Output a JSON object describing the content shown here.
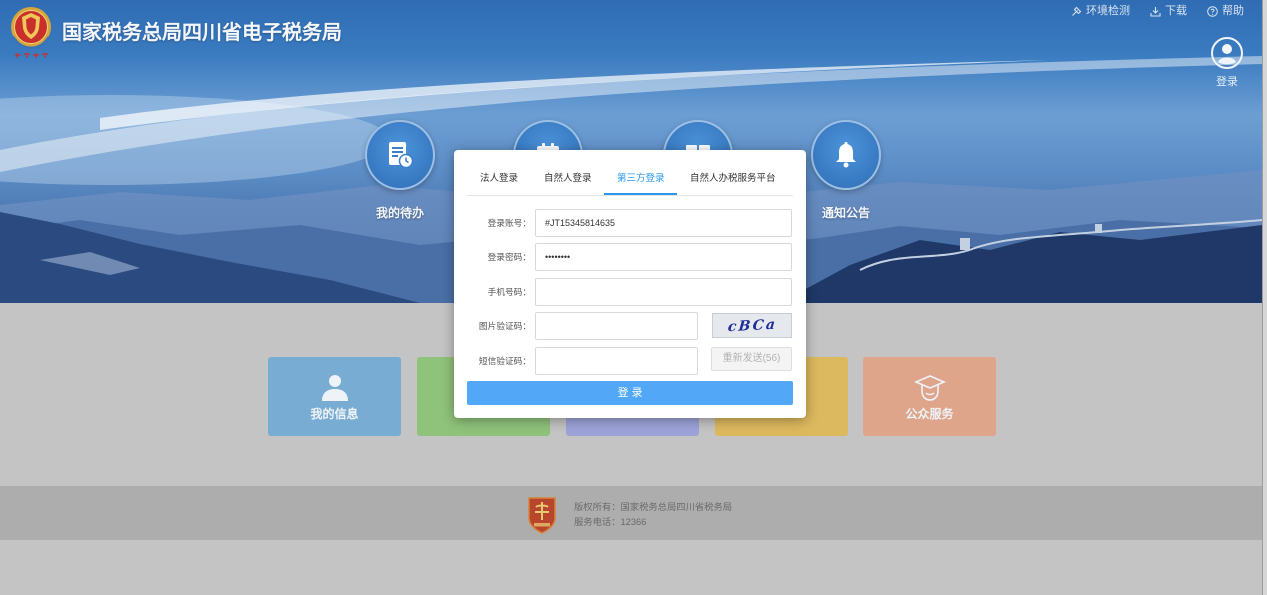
{
  "header": {
    "title": "国家税务总局四川省电子税务局",
    "links": [
      {
        "label": "环境检测",
        "icon": "env-check-icon"
      },
      {
        "label": "下载",
        "icon": "download-icon"
      },
      {
        "label": "帮助",
        "icon": "help-icon"
      }
    ],
    "user": {
      "label": "登录",
      "icon": "user-avatar-icon"
    }
  },
  "banner_nav": [
    {
      "label": "我的待办",
      "icon": "todo-document-icon"
    },
    {
      "icon": "calendar-icon"
    },
    {
      "icon": "book-icon"
    },
    {
      "label": "通知公告",
      "icon": "bell-icon"
    }
  ],
  "tiles": [
    {
      "label": "我的信息",
      "icon": "person-icon",
      "color": "#79acd3"
    },
    {
      "color": "#8fc27b"
    },
    {
      "color": "#9da3d8"
    },
    {
      "color": "#dcb85e"
    },
    {
      "label": "公众服务",
      "icon": "graduation-cap-icon",
      "color": "#dfa58b"
    }
  ],
  "footer": {
    "copyright": "版权所有：国家税务总局四川省税务局",
    "phone": "服务电话：12366"
  },
  "login_modal": {
    "tabs": [
      {
        "label": "法人登录",
        "active": false
      },
      {
        "label": "自然人登录",
        "active": false
      },
      {
        "label": "第三方登录",
        "active": true
      },
      {
        "label": "自然人办税服务平台",
        "active": false
      }
    ],
    "fields": [
      {
        "label": "登录账号：",
        "value": "#JT15345814635"
      },
      {
        "label": "登录密码：",
        "value": "••••••••"
      },
      {
        "label": "手机号码：",
        "value": ""
      },
      {
        "label": "图片验证码：",
        "value": ""
      },
      {
        "label": "短信验证码：",
        "value": ""
      }
    ],
    "captcha_text": "cBCa",
    "resend_label": "重新发送(56)",
    "submit_label": "登 录"
  },
  "colors": {
    "accent": "#2a98ee",
    "submit_button": "#52a8f6",
    "page_background": "#c4c4c4",
    "footer_background": "#adadad"
  }
}
